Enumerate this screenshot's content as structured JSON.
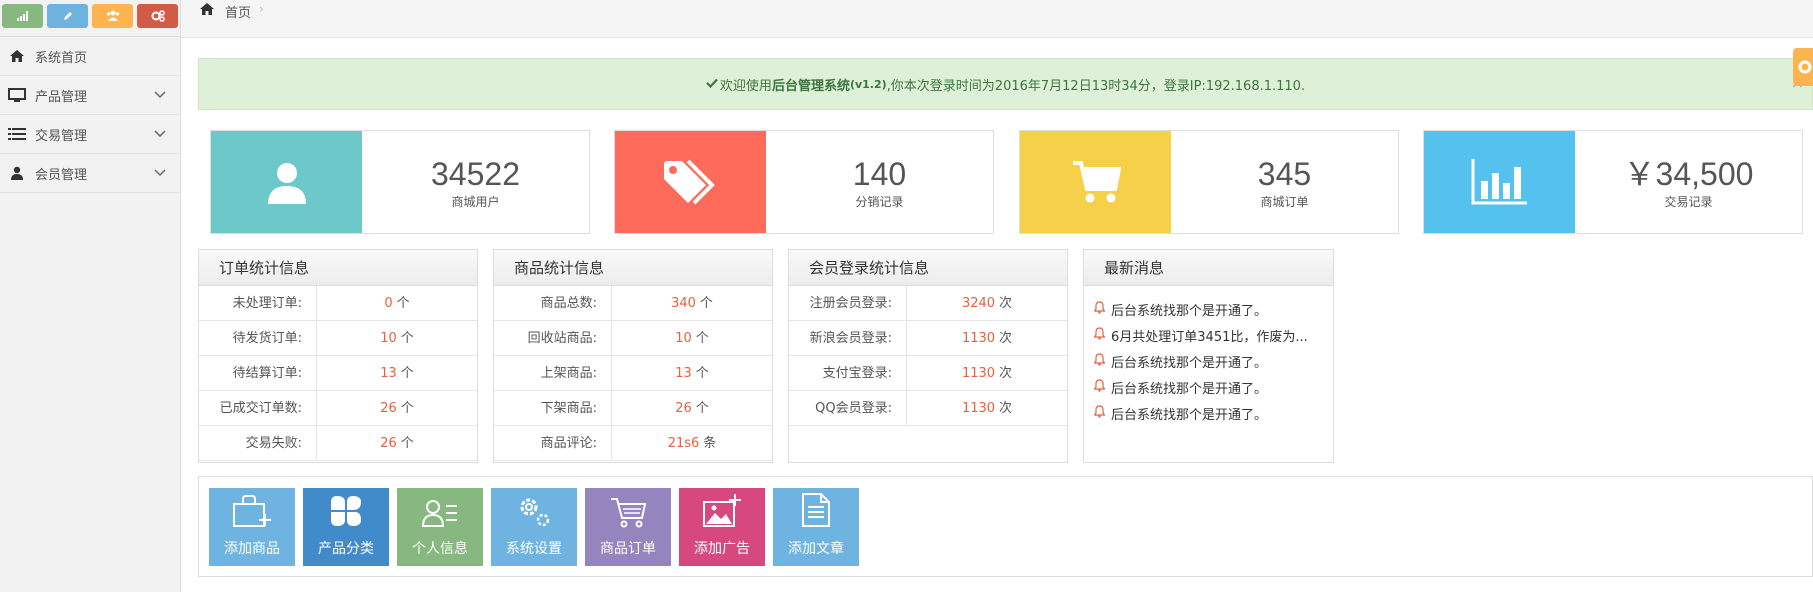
{
  "colors": {
    "green": "#87b87f",
    "blue": "#6fb3e0",
    "orange": "#fbb450",
    "red": "#d15b47",
    "teal": "#6cc8c9",
    "coral": "#ff6b5b",
    "yellow": "#f7d04a",
    "sky": "#55c1ee",
    "accent_number": "#e8613f"
  },
  "shortcut_buttons": [
    {
      "icon": "signal-icon",
      "color": "#87b87f"
    },
    {
      "icon": "pencil-icon",
      "color": "#6fb3e0"
    },
    {
      "icon": "users-icon",
      "color": "#fbb450"
    },
    {
      "icon": "cogs-icon",
      "color": "#d15b47"
    }
  ],
  "sidebar": {
    "items": [
      {
        "label": "系统首页",
        "icon": "home-icon"
      },
      {
        "label": "产品管理",
        "icon": "desktop-icon",
        "expandable": true
      },
      {
        "label": "交易管理",
        "icon": "list-icon",
        "expandable": true
      },
      {
        "label": "会员管理",
        "icon": "user-icon",
        "expandable": true
      }
    ]
  },
  "breadcrumb": {
    "home": "首页",
    "separator": "›"
  },
  "alert": {
    "prefix": "欢迎使用",
    "system": "后台管理系统",
    "version": "(v1.2)",
    "suffix": ",你本次登录时间为2016年7月12日13时34分，登录IP:192.168.1.110.",
    "close": "×"
  },
  "stats": [
    {
      "value": "34522",
      "label": "商城用户",
      "icon": "user-icon",
      "color": "#6cc8c9"
    },
    {
      "value": "140",
      "label": "分销记录",
      "icon": "tags-icon",
      "color": "#ff6b5b"
    },
    {
      "value": "345",
      "label": "商城订单",
      "icon": "cart-icon",
      "color": "#f7d04a"
    },
    {
      "value": "￥34,500",
      "label": "交易记录",
      "icon": "bar-chart-icon",
      "color": "#55c1ee"
    }
  ],
  "order_stats": {
    "title": "订单统计信息",
    "rows": [
      {
        "k": "未处理订单:",
        "n": "0",
        "u": "个"
      },
      {
        "k": "待发货订单:",
        "n": "10",
        "u": "个"
      },
      {
        "k": "待结算订单:",
        "n": "13",
        "u": "个"
      },
      {
        "k": "已成交订单数:",
        "n": "26",
        "u": "个"
      },
      {
        "k": "交易失败:",
        "n": "26",
        "u": "个"
      }
    ]
  },
  "product_stats": {
    "title": "商品统计信息",
    "rows": [
      {
        "k": "商品总数:",
        "n": "340",
        "u": "个"
      },
      {
        "k": "回收站商品:",
        "n": "10",
        "u": "个"
      },
      {
        "k": "上架商品:",
        "n": "13",
        "u": "个"
      },
      {
        "k": "下架商品:",
        "n": "26",
        "u": "个"
      },
      {
        "k": "商品评论:",
        "n": "21s6",
        "u": "条"
      }
    ]
  },
  "login_stats": {
    "title": "会员登录统计信息",
    "rows": [
      {
        "k": "注册会员登录:",
        "n": "3240",
        "u": "次"
      },
      {
        "k": "新浪会员登录:",
        "n": "1130",
        "u": "次"
      },
      {
        "k": "支付宝登录:",
        "n": "1130",
        "u": "次"
      },
      {
        "k": "QQ会员登录:",
        "n": "1130",
        "u": "次"
      }
    ]
  },
  "news": {
    "title": "最新消息",
    "items": [
      "后台系统找那个是开通了。",
      "6月共处理订单3451比，作废为...",
      "后台系统找那个是开通了。",
      "后台系统找那个是开通了。",
      "后台系统找那个是开通了。"
    ]
  },
  "quick_buttons": [
    {
      "label": "添加商品",
      "icon": "add-bag-icon",
      "color": "#6fb3e0"
    },
    {
      "label": "产品分类",
      "icon": "category-icon",
      "color": "#428bca"
    },
    {
      "label": "个人信息",
      "icon": "profile-icon",
      "color": "#87b87f"
    },
    {
      "label": "系统设置",
      "icon": "settings-icon",
      "color": "#6fb3e0"
    },
    {
      "label": "商品订单",
      "icon": "cart-icon",
      "color": "#9585bf"
    },
    {
      "label": "添加广告",
      "icon": "add-image-icon",
      "color": "#d6487e"
    },
    {
      "label": "添加文章",
      "icon": "document-icon",
      "color": "#6fb3e0"
    }
  ]
}
